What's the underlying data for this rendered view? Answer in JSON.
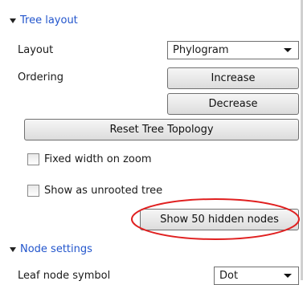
{
  "tree_layout": {
    "title": "Tree layout",
    "layout_label": "Layout",
    "layout_value": "Phylogram",
    "ordering_label": "Ordering",
    "increase_label": "Increase",
    "decrease_label": "Decrease",
    "reset_label": "Reset Tree Topology",
    "fixed_width_label": "Fixed width on zoom",
    "fixed_width_checked": false,
    "unrooted_label": "Show as unrooted tree",
    "unrooted_checked": false,
    "show_hidden_label": "Show 50 hidden nodes",
    "highlight_color": "#e02020"
  },
  "node_settings": {
    "title": "Node settings",
    "leaf_symbol_label": "Leaf node symbol",
    "leaf_symbol_value": "Dot"
  }
}
